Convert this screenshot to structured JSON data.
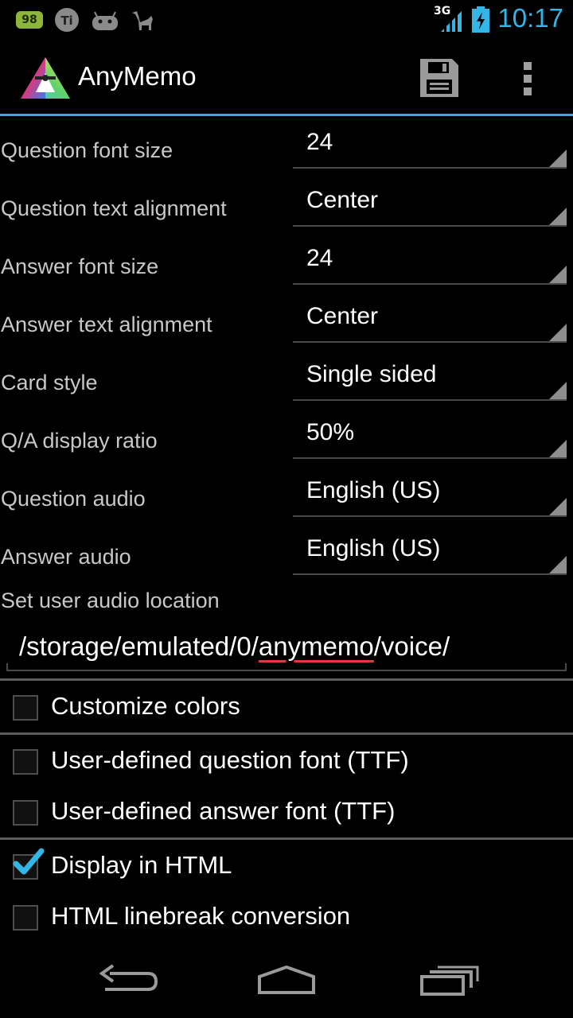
{
  "status_bar": {
    "battery_badge": "98",
    "network": "3G",
    "clock": "10:17",
    "icons": [
      "battery-badge-icon",
      "titanium-icon",
      "android-icon",
      "camel-icon",
      "signal-icon",
      "battery-icon"
    ]
  },
  "action_bar": {
    "title": "AnyMemo",
    "icons": [
      "app-logo-icon",
      "save-icon",
      "overflow-menu-icon"
    ]
  },
  "settings": [
    {
      "label": "Question font size",
      "value": "24"
    },
    {
      "label": "Question text alignment",
      "value": "Center"
    },
    {
      "label": "Answer font size",
      "value": "24"
    },
    {
      "label": "Answer text alignment",
      "value": "Center"
    },
    {
      "label": "Card style",
      "value": "Single sided"
    },
    {
      "label": "Q/A display ratio",
      "value": "50%"
    },
    {
      "label": "Question audio",
      "value": "English (US)"
    },
    {
      "label": "Answer audio",
      "value": "English (US)"
    }
  ],
  "audio_location": {
    "label": "Set user audio location",
    "value_prefix": "/storage/emulated/0/",
    "value_flagged": "anymemo",
    "value_suffix": "/voice/"
  },
  "checkboxes": [
    {
      "label": "Customize colors",
      "checked": false
    },
    {
      "label": "User-defined question font (TTF)",
      "checked": false
    },
    {
      "label": "User-defined answer font (TTF)",
      "checked": false
    },
    {
      "label": "Display in HTML",
      "checked": true
    },
    {
      "label": "HTML linebreak conversion",
      "checked": false
    }
  ],
  "nav_bar": {
    "icons": [
      "back-icon",
      "home-icon",
      "recent-apps-icon"
    ]
  },
  "colors": {
    "accent": "#33b5e5",
    "divider": "#3ea8d8",
    "spellcheck": "#e0393e"
  }
}
